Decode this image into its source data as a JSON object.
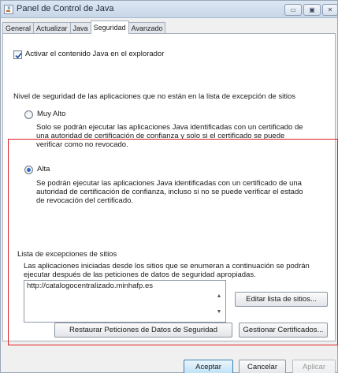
{
  "window": {
    "title": "Panel de Control de Java",
    "controls": {
      "minimize": "▭",
      "maximize": "▣",
      "close": "✕"
    }
  },
  "tabs": [
    {
      "label": "General",
      "active": false
    },
    {
      "label": "Actualizar",
      "active": false
    },
    {
      "label": "Java",
      "active": false
    },
    {
      "label": "Seguridad",
      "active": true
    },
    {
      "label": "Avanzado",
      "active": false
    }
  ],
  "security": {
    "enable_java_label": "Activar el contenido Java en el explorador",
    "enable_java_checked": true,
    "level_heading": "Nivel de seguridad de las aplicaciones que no están en la lista de excepción de sitios",
    "very_high": {
      "label": "Muy Alto",
      "checked": false,
      "desc_line1": "Solo se podrán ejecutar las aplicaciones Java identificadas con un certificado de",
      "desc_line2": "una autoridad de certificación de confianza y solo si el certificado se puede",
      "desc_line3": "verificar como no revocado."
    },
    "high": {
      "label": "Alta",
      "checked": true,
      "desc_line1": "Se podrán ejecutar las aplicaciones Java identificadas con un certificado de una",
      "desc_line2": "autoridad de certificación de confianza, incluso si no se puede verificar el estado",
      "desc_line3": "de revocación del certificado."
    },
    "exceptions": {
      "heading": "Lista de excepciones de sitios",
      "desc_line1": "Las aplicaciones iniciadas desde los sitios que se enumeran a continuación se podrán",
      "desc_line2": "ejecutar después de las peticiones de datos de seguridad apropiadas.",
      "sites": [
        "http://catalogocentralizado.minhafp.es"
      ],
      "edit_button": "Editar lista de sitios..."
    },
    "restore_button": "Restaurar Peticiones de Datos de Seguridad",
    "certificates_button": "Gestionar Certificados..."
  },
  "footer": {
    "accept": "Aceptar",
    "cancel": "Cancelar",
    "apply": "Aplicar"
  },
  "colors": {
    "highlight": "#e02020",
    "radio_selected": "#2c6ec8"
  },
  "icons": {
    "app": "java-cup-icon",
    "checkbox": "checkmark-icon",
    "scroll_up": "arrow-up-icon",
    "scroll_down": "arrow-down-icon"
  }
}
